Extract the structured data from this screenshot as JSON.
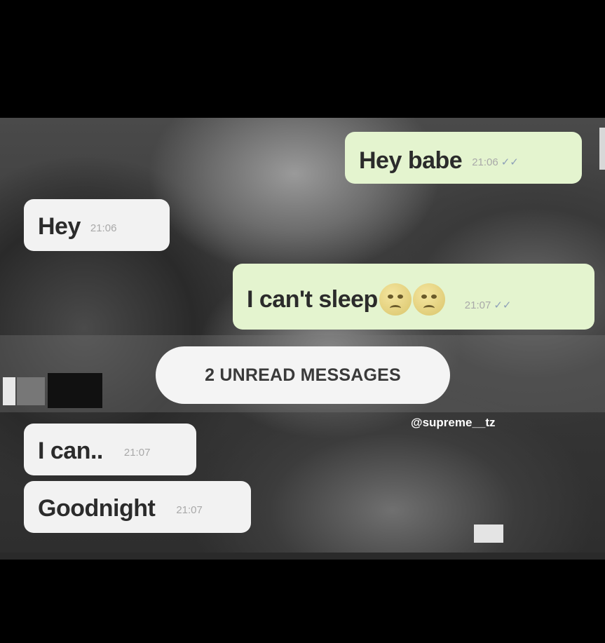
{
  "chat": {
    "messages": [
      {
        "from": "me",
        "text": "Hey babe",
        "time": "21:06",
        "status": "✓✓"
      },
      {
        "from": "them",
        "text": "Hey",
        "time": "21:06"
      },
      {
        "from": "me",
        "text": "I can't sleep",
        "time": "21:07",
        "status": "✓✓"
      },
      {
        "from": "them",
        "text": "I can..",
        "time": "21:07"
      },
      {
        "from": "them",
        "text": "Goodnight",
        "time": "21:07"
      }
    ],
    "unread_divider": "2 UNREAD MESSAGES",
    "watermark": "@supreme__tz"
  },
  "colors": {
    "outgoing_bubble": "#e4f4cf",
    "incoming_bubble": "#f2f2f2",
    "background": "#000000"
  },
  "icons": [
    "double-check-icon",
    "weary-face-emoji"
  ]
}
